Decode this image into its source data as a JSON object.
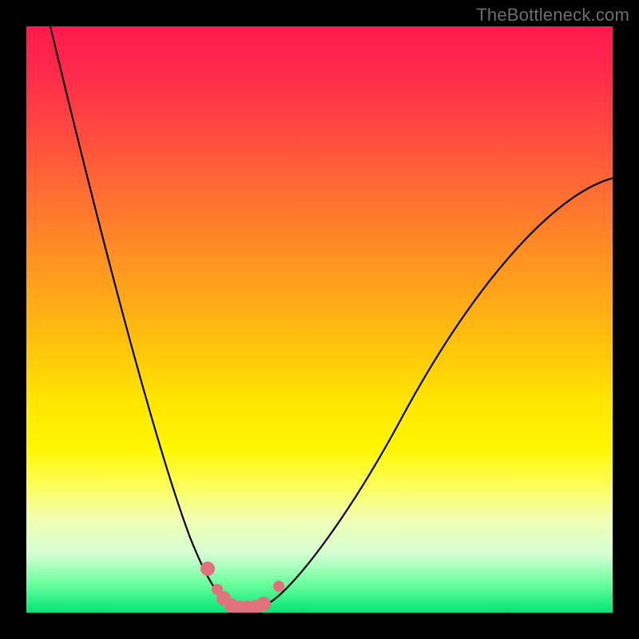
{
  "watermark": "TheBottleneck.com",
  "chart_data": {
    "type": "line",
    "title": "",
    "xlabel": "",
    "ylabel": "",
    "xlim": [
      0,
      100
    ],
    "ylim": [
      0,
      100
    ],
    "background_gradient_stops": [
      {
        "pct": 0,
        "color": "#ff1a4d"
      },
      {
        "pct": 8,
        "color": "#ff2b4b"
      },
      {
        "pct": 18,
        "color": "#ff4a3f"
      },
      {
        "pct": 30,
        "color": "#ff7330"
      },
      {
        "pct": 42,
        "color": "#ff9a1e"
      },
      {
        "pct": 54,
        "color": "#ffc20c"
      },
      {
        "pct": 64,
        "color": "#ffe600"
      },
      {
        "pct": 72,
        "color": "#fff700"
      },
      {
        "pct": 78,
        "color": "#fdfd56"
      },
      {
        "pct": 84,
        "color": "#f2ffb2"
      },
      {
        "pct": 90,
        "color": "#d4ffd4"
      },
      {
        "pct": 95,
        "color": "#6dff9d"
      },
      {
        "pct": 100,
        "color": "#00e676"
      }
    ],
    "series": [
      {
        "name": "bottleneck-curve",
        "color": "#000000",
        "x": [
          4,
          8,
          12,
          16,
          20,
          24,
          27,
          30,
          32,
          34,
          36,
          38,
          40,
          42,
          45,
          50,
          55,
          60,
          65,
          70,
          75,
          80,
          85,
          90,
          95,
          100
        ],
        "y": [
          100,
          82,
          66,
          52,
          40,
          28,
          18,
          10,
          6,
          3,
          1,
          0,
          0,
          1,
          3,
          8,
          15,
          23,
          31,
          39,
          47,
          54,
          61,
          67,
          72,
          74
        ]
      }
    ],
    "markers": {
      "color": "#e2717e",
      "x": [
        30.9,
        32.6,
        33.6,
        35.0,
        36.3,
        37.7,
        39.0,
        40.4,
        43.0
      ],
      "y": [
        7.5,
        3.9,
        2.5,
        1.2,
        0.8,
        0.8,
        0.9,
        1.5,
        4.5
      ],
      "radius_px": [
        9,
        7,
        9,
        9,
        9,
        9,
        9,
        9,
        7
      ]
    }
  }
}
